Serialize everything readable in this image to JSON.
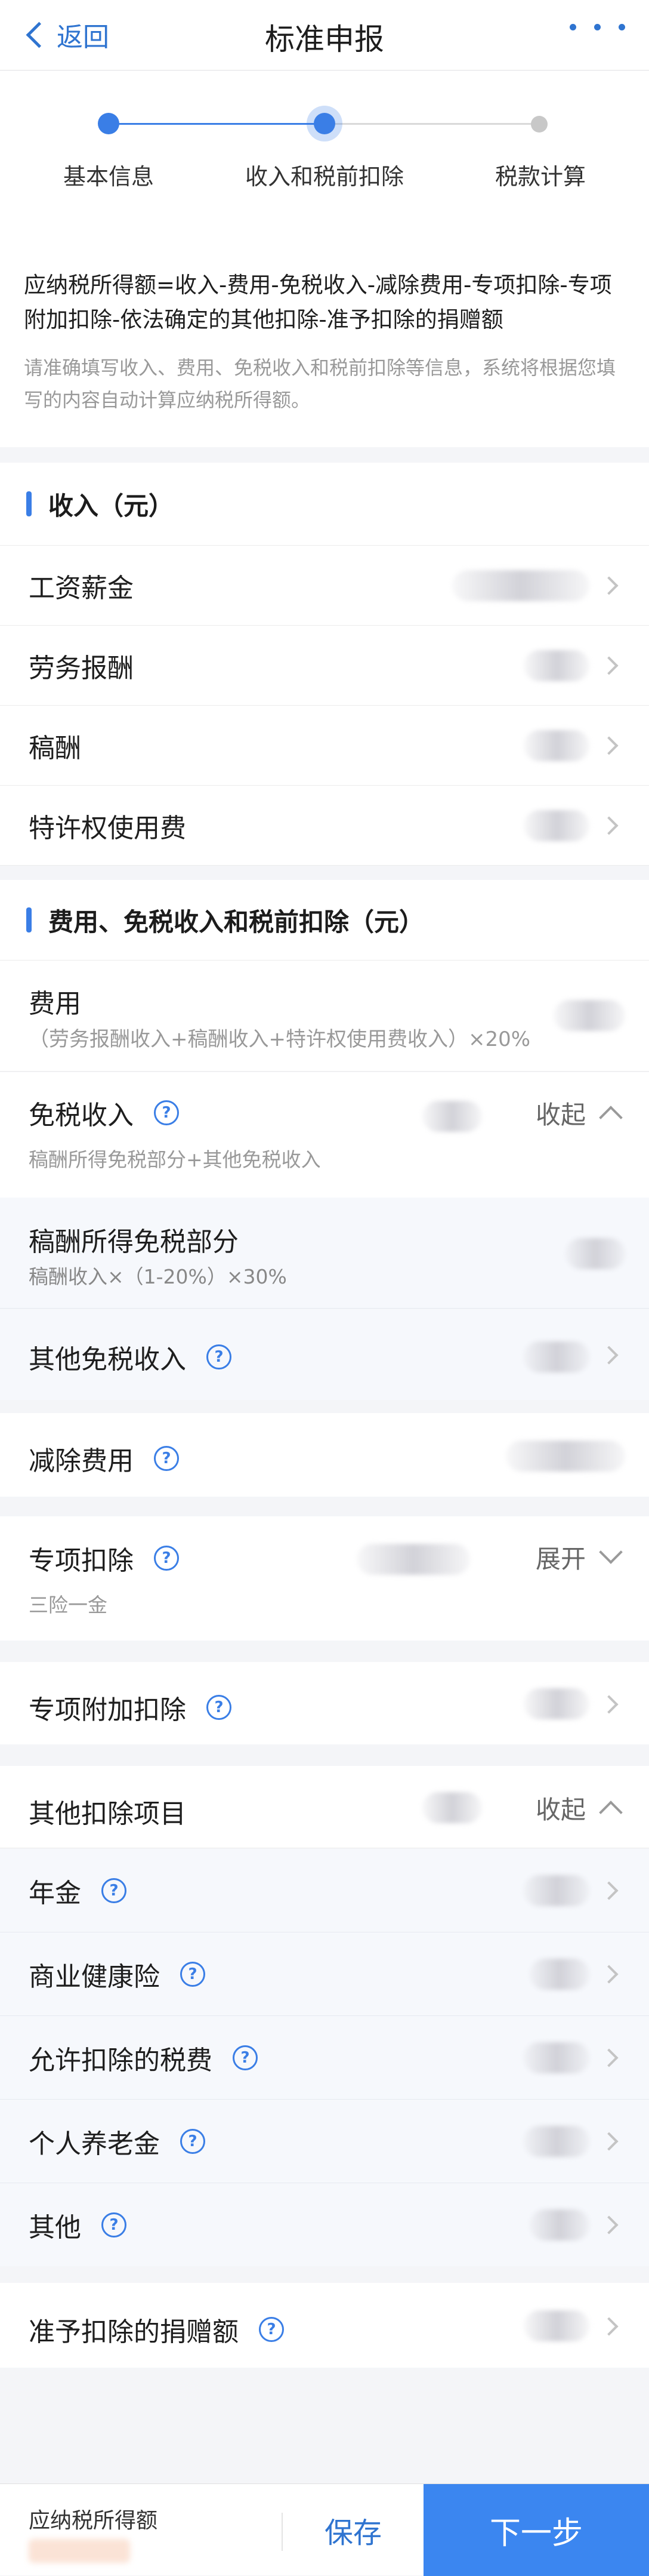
{
  "nav": {
    "back_label": "返回",
    "title": "标准申报"
  },
  "steps": [
    {
      "label": "基本信息"
    },
    {
      "label": "收入和税前扣除"
    },
    {
      "label": "税款计算"
    }
  ],
  "formula": {
    "main": "应纳税所得额=收入-费用-免税收入-减除费用-专项扣除-专项附加扣除-依法确定的其他扣除-准予扣除的捐赠额",
    "sub": "请准确填写收入、费用、免税收入和税前扣除等信息，系统将根据您填写的内容自动计算应纳税所得额。"
  },
  "income_section": {
    "title": "收入（元）",
    "items": [
      {
        "label": "工资薪金"
      },
      {
        "label": "劳务报酬"
      },
      {
        "label": "稿酬"
      },
      {
        "label": "特许权使用费"
      }
    ]
  },
  "deduction_section": {
    "title": "费用、免税收入和税前扣除（元）",
    "expense": {
      "label": "费用",
      "note": "（劳务报酬收入+稿酬收入+特许权使用费收入）×20%"
    },
    "tax_free": {
      "label": "免税收入",
      "toggle": "收起",
      "note": "稿酬所得免税部分+其他免税收入",
      "royalty_free": {
        "label": "稿酬所得免税部分",
        "note": "稿酬收入×（1-20%）×30%"
      },
      "other_free": {
        "label": "其他免税收入"
      }
    },
    "reduction": {
      "label": "减除费用"
    },
    "special": {
      "label": "专项扣除",
      "toggle": "展开",
      "note": "三险一金"
    },
    "special_additional": {
      "label": "专项附加扣除"
    },
    "other": {
      "label": "其他扣除项目",
      "toggle": "收起",
      "items": [
        {
          "label": "年金"
        },
        {
          "label": "商业健康险"
        },
        {
          "label": "允许扣除的税费"
        },
        {
          "label": "个人养老金"
        },
        {
          "label": "其他"
        }
      ]
    },
    "donation": {
      "label": "准予扣除的捐赠额"
    }
  },
  "bottom": {
    "label": "应纳税所得额",
    "save": "保存",
    "next": "下一步"
  },
  "icons": {
    "help": "question-circle-icon",
    "arrow": "chevron-right-icon"
  },
  "colors": {
    "accent": "#3a7ee6",
    "next_button": "#3b86f0"
  }
}
